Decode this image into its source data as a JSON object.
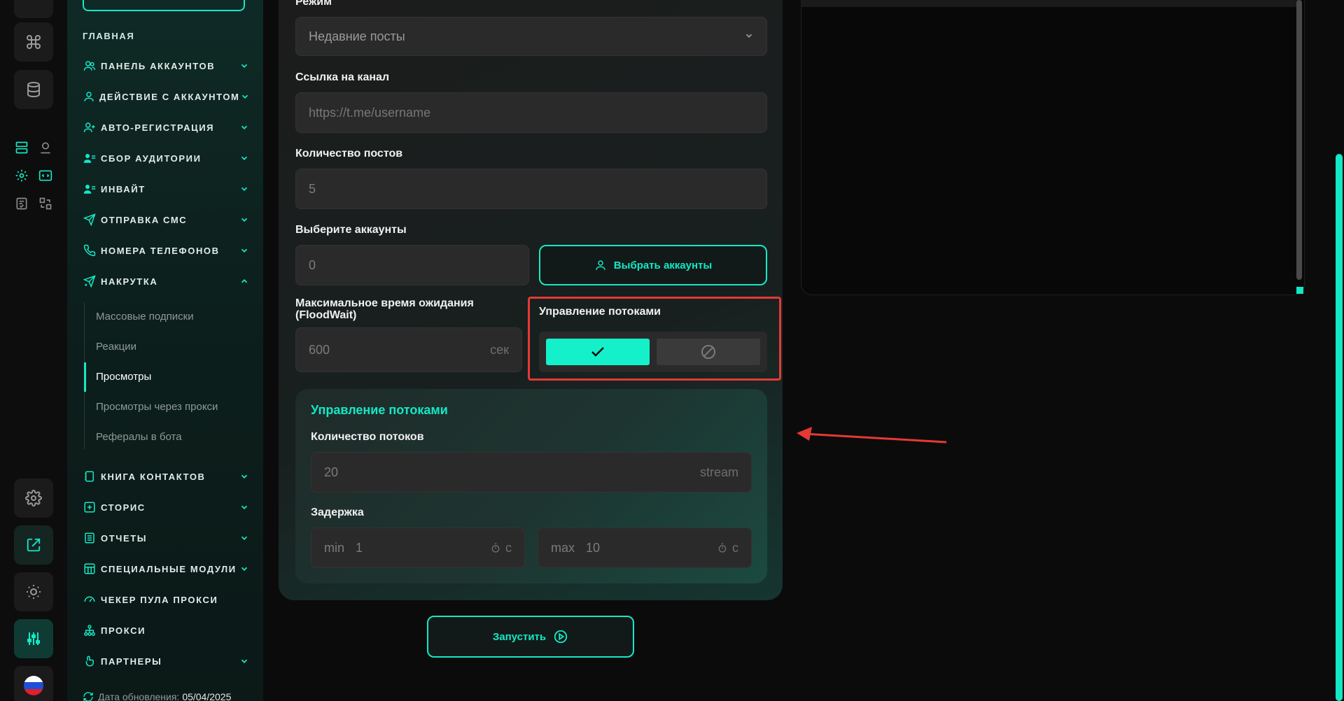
{
  "sidebar": {
    "section_title": "ГЛАВНАЯ",
    "items": [
      {
        "label": "ПАНЕЛЬ АККАУНТОВ",
        "icon": "users-icon",
        "chevron": "down"
      },
      {
        "label": "ДЕЙСТВИЕ С АККАУНТОМ",
        "icon": "user-icon",
        "chevron": "down"
      },
      {
        "label": "АВТО-РЕГИСТРАЦИЯ",
        "icon": "user-plus-icon",
        "chevron": "down"
      },
      {
        "label": "СБОР АУДИТОРИИ",
        "icon": "user-list-icon",
        "chevron": "down"
      },
      {
        "label": "ИНВАЙТ",
        "icon": "user-list-icon",
        "chevron": "down"
      },
      {
        "label": "ОТПРАВКА СМС",
        "icon": "send-icon",
        "chevron": "down"
      },
      {
        "label": "НОМЕРА ТЕЛЕФОНОВ",
        "icon": "phone-icon",
        "chevron": "down"
      },
      {
        "label": "НАКРУТКА",
        "icon": "send-plus-icon",
        "chevron": "up"
      }
    ],
    "sub_items": [
      "Массовые подписки",
      "Реакции",
      "Просмотры",
      "Просмотры через прокси",
      "Рефералы в бота"
    ],
    "active_sub": "Просмотры",
    "items_after": [
      {
        "label": "КНИГА КОНТАКТОВ",
        "icon": "book-icon",
        "chevron": "down"
      },
      {
        "label": "СТОРИС",
        "icon": "plus-square-icon",
        "chevron": "down"
      },
      {
        "label": "ОТЧЕТЫ",
        "icon": "report-icon",
        "chevron": "down"
      },
      {
        "label": "СПЕЦИАЛЬНЫЕ МОДУЛИ",
        "icon": "modules-icon",
        "chevron": "down"
      },
      {
        "label": "ЧЕКЕР ПУЛА ПРОКСИ",
        "icon": "gauge-icon",
        "chevron": ""
      },
      {
        "label": "ПРОКСИ",
        "icon": "network-icon",
        "chevron": ""
      },
      {
        "label": "ПАРТНЕРЫ",
        "icon": "hand-icon",
        "chevron": "down"
      }
    ],
    "update_label": "Дата обновления:",
    "update_value": "05/04/2025"
  },
  "form": {
    "mode_label": "Режим",
    "mode_value": "Недавние посты",
    "channel_label": "Ссылка на канал",
    "channel_placeholder": "https://t.me/username",
    "posts_label": "Количество постов",
    "posts_value": "5",
    "accounts_label": "Выберите аккаунты",
    "accounts_value": "0",
    "choose_accounts_button": "Выбрать аккаунты",
    "floodwait_label_line1": "Максимальное время ожидания",
    "floodwait_label_line2": "(FloodWait)",
    "floodwait_value": "600",
    "floodwait_unit": "сек",
    "threads_toggle_label": "Управление потоками",
    "threads_toggle_state": "on"
  },
  "threads_card": {
    "title": "Управление потоками",
    "count_label": "Количество потоков",
    "count_value": "20",
    "count_unit": "stream",
    "delay_label": "Задержка",
    "min_prefix": "min",
    "min_value": "1",
    "max_prefix": "max",
    "max_value": "10",
    "delay_unit": "с"
  },
  "run_button": "Запустить",
  "colors": {
    "accent": "#14e8c5",
    "highlight": "#e53935",
    "background": "#0b0b0b"
  }
}
